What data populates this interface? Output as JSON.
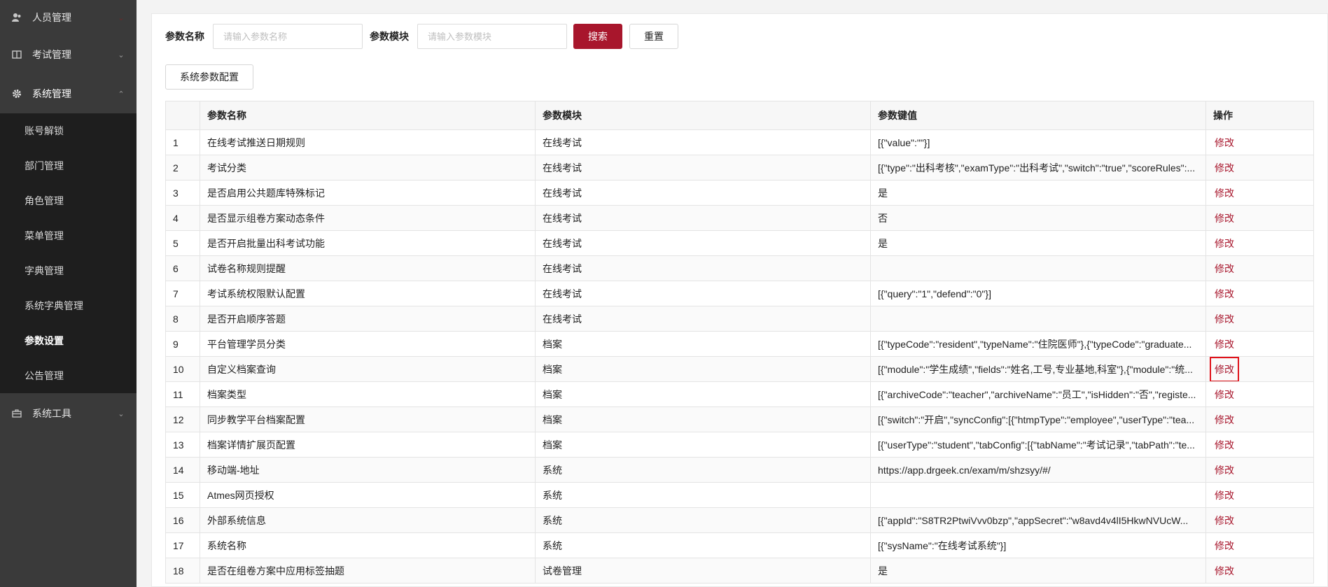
{
  "sidebar": {
    "groups": [
      {
        "label": "人员管理",
        "icon": "user-icon"
      },
      {
        "label": "考试管理",
        "icon": "book-icon"
      },
      {
        "label": "系统管理",
        "icon": "gear-icon"
      },
      {
        "label": "系统工具",
        "icon": "toolbox-icon"
      }
    ],
    "submenu": [
      "账号解锁",
      "部门管理",
      "角色管理",
      "菜单管理",
      "字典管理",
      "系统字典管理",
      "参数设置",
      "公告管理"
    ]
  },
  "search": {
    "name_label": "参数名称",
    "name_placeholder": "请输入参数名称",
    "module_label": "参数模块",
    "module_placeholder": "请输入参数模块",
    "search_button": "搜索",
    "reset_button": "重置"
  },
  "config_button": "系统参数配置",
  "table": {
    "headers": [
      "",
      "参数名称",
      "参数模块",
      "参数键值",
      "操作"
    ],
    "action_label": "修改",
    "rows": [
      {
        "no": "1",
        "name": "在线考试推送日期规则",
        "module": "在线考试",
        "value": "[{\"value\":\"\"}]"
      },
      {
        "no": "2",
        "name": "考试分类",
        "module": "在线考试",
        "value": "[{\"type\":\"出科考核\",\"examType\":\"出科考试\",\"switch\":\"true\",\"scoreRules\":..."
      },
      {
        "no": "3",
        "name": "是否启用公共题库特殊标记",
        "module": "在线考试",
        "value": "是"
      },
      {
        "no": "4",
        "name": "是否显示组卷方案动态条件",
        "module": "在线考试",
        "value": "否"
      },
      {
        "no": "5",
        "name": "是否开启批量出科考试功能",
        "module": "在线考试",
        "value": "是"
      },
      {
        "no": "6",
        "name": "试卷名称规则提醒",
        "module": "在线考试",
        "value": ""
      },
      {
        "no": "7",
        "name": "考试系统权限默认配置",
        "module": "在线考试",
        "value": "[{\"query\":\"1\",\"defend\":\"0\"}]"
      },
      {
        "no": "8",
        "name": "是否开启顺序答题",
        "module": "在线考试",
        "value": ""
      },
      {
        "no": "9",
        "name": "平台管理学员分类",
        "module": "档案",
        "value": "[{\"typeCode\":\"resident\",\"typeName\":\"住院医师\"},{\"typeCode\":\"graduate..."
      },
      {
        "no": "10",
        "name": "自定义档案查询",
        "module": "档案",
        "value": "[{\"module\":\"学生成绩\",\"fields\":\"姓名,工号,专业基地,科室\"},{\"module\":\"统..."
      },
      {
        "no": "11",
        "name": "档案类型",
        "module": "档案",
        "value": "[{\"archiveCode\":\"teacher\",\"archiveName\":\"员工\",\"isHidden\":\"否\",\"registe..."
      },
      {
        "no": "12",
        "name": "同步教学平台档案配置",
        "module": "档案",
        "value": "[{\"switch\":\"开启\",\"syncConfig\":[{\"htmpType\":\"employee\",\"userType\":\"tea..."
      },
      {
        "no": "13",
        "name": "档案详情扩展页配置",
        "module": "档案",
        "value": "[{\"userType\":\"student\",\"tabConfig\":[{\"tabName\":\"考试记录\",\"tabPath\":\"te..."
      },
      {
        "no": "14",
        "name": "移动端-地址",
        "module": "系统",
        "value": "https://app.drgeek.cn/exam/m/shzsyy/#/"
      },
      {
        "no": "15",
        "name": "Atmes网页授权",
        "module": "系统",
        "value": ""
      },
      {
        "no": "16",
        "name": "外部系统信息",
        "module": "系统",
        "value": "[{\"appId\":\"S8TR2PtwiVvv0bzp\",\"appSecret\":\"w8avd4v4lI5HkwNVUcW..."
      },
      {
        "no": "17",
        "name": "系统名称",
        "module": "系统",
        "value": "[{\"sysName\":\"在线考试系统\"}]"
      },
      {
        "no": "18",
        "name": "是否在组卷方案中应用标签抽题",
        "module": "试卷管理",
        "value": "是"
      }
    ]
  }
}
